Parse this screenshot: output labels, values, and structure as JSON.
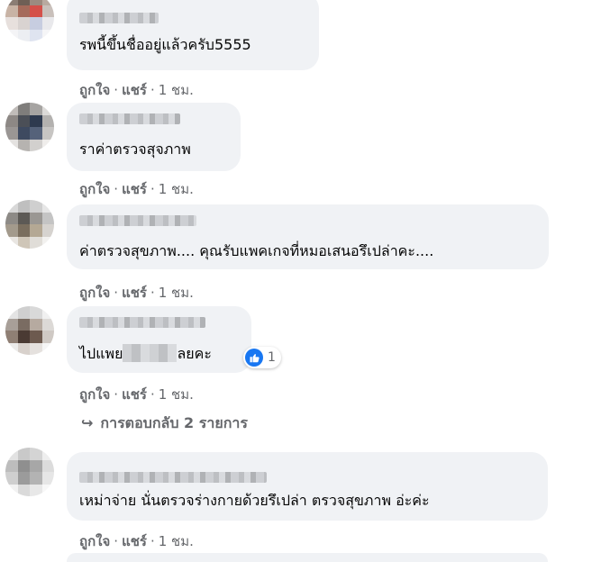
{
  "comments": [
    {
      "text": "รพนี้ขึ้นชื่ออยู่แล้วครับ5555",
      "like": "ถูกใจ",
      "share": "แชร์",
      "sep": "·",
      "time": "1 ชม."
    },
    {
      "text": "ราค่าตรวจสุจภาพ",
      "like": "ถูกใจ",
      "share": "แชร์",
      "sep": "·",
      "time": "1 ชม."
    },
    {
      "text": "ค่าตรวจสุขภาพ.... คุณรับแพคเกจที่หมอเสนอรึเปล่าคะ....",
      "like": "ถูกใจ",
      "share": "แชร์",
      "sep": "·",
      "time": "1 ชม."
    },
    {
      "text_before": "ไปแพย",
      "text_after": "ลยคะ",
      "like": "ถูกใจ",
      "share": "แชร์",
      "sep": "·",
      "time": "1 ชม.",
      "reaction": {
        "icon": "thumbs-up-icon",
        "count": "1",
        "color": "#1877f2"
      }
    },
    {
      "text": "เหม่าจ่าย นั่นตรวจร่างกายด้วยรึเปล่า ตรวจสุขภาพ อ่ะค่ะ",
      "like": "ถูกใจ",
      "share": "แชร์",
      "sep": "·",
      "time": "1 ชม."
    }
  ],
  "replies": {
    "arrow": "↪",
    "label": "การตอบกลับ 2 รายการ"
  },
  "colors": {
    "bubble": "#f0f2f5",
    "meta": "#65676b",
    "text": "#050505",
    "accent": "#1877f2"
  }
}
